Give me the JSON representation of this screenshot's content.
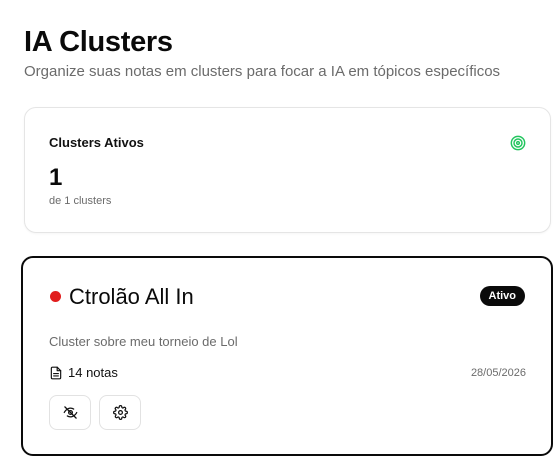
{
  "header": {
    "title": "IA Clusters",
    "subtitle": "Organize suas notas em clusters para focar a IA em tópicos específicos"
  },
  "stats": {
    "label": "Clusters Ativos",
    "value": "1",
    "sub": "de 1 clusters",
    "icon": "target-icon",
    "accent_color": "#22c55e"
  },
  "cluster": {
    "name": "Ctrolão All In",
    "status_color": "#e11d1d",
    "badge": "Ativo",
    "description": "Cluster sobre meu torneio de Lol",
    "notes_count": "14 notas",
    "date": "28/05/2026",
    "actions": [
      {
        "icon": "eye-off-icon"
      },
      {
        "icon": "gear-icon"
      }
    ]
  }
}
